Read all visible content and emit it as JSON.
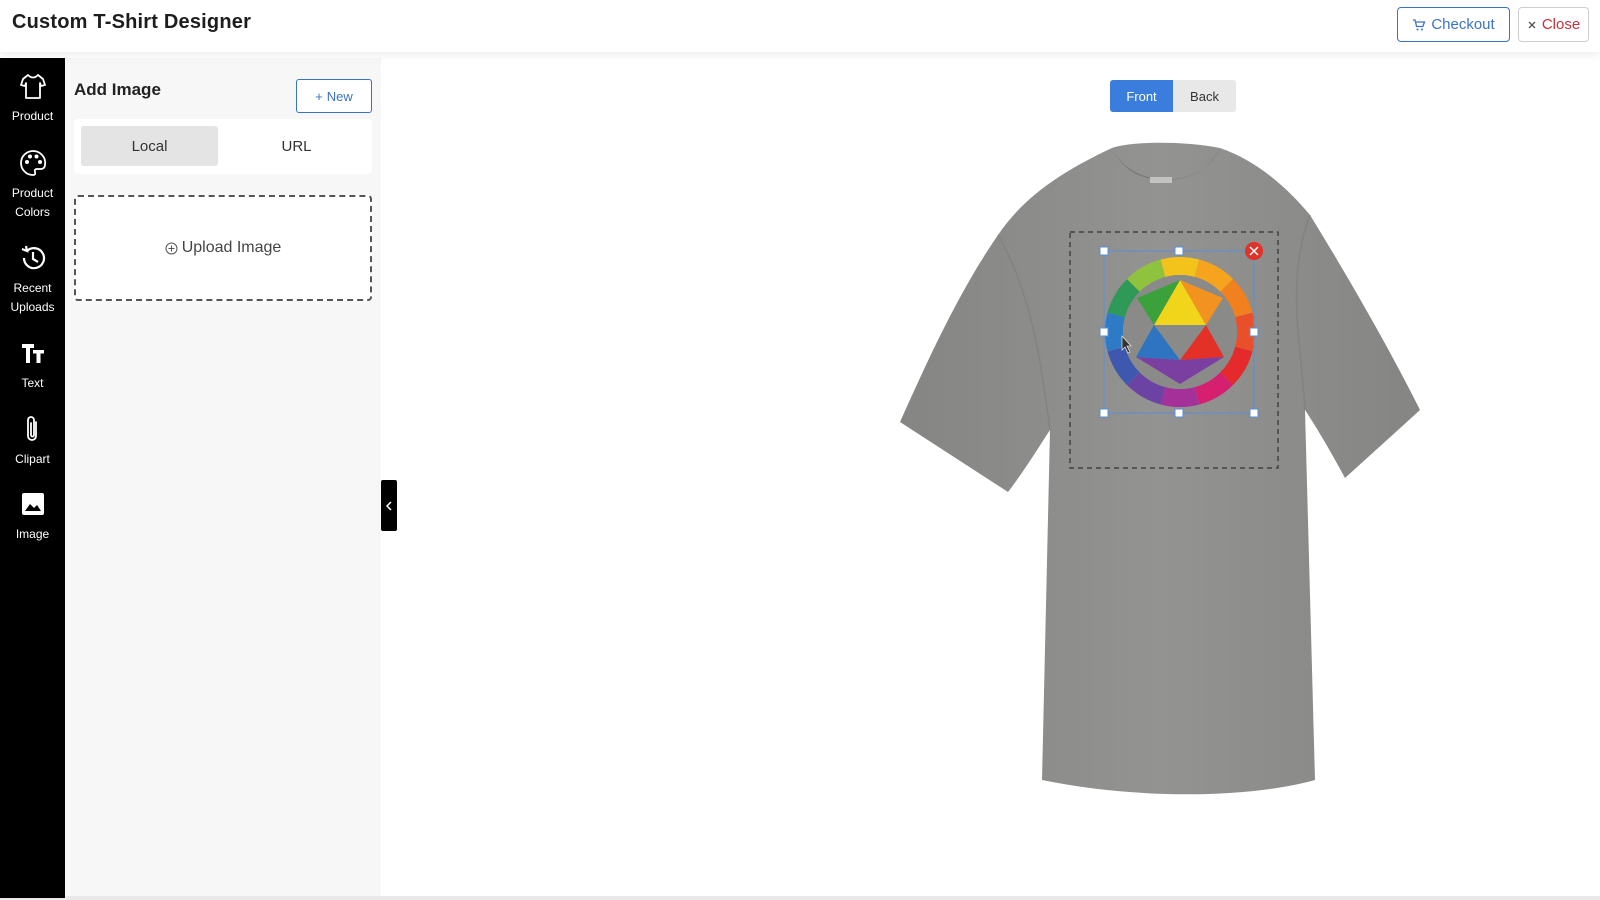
{
  "header": {
    "title": "Custom T-Shirt Designer",
    "checkout_label": "Checkout",
    "close_label": "Close"
  },
  "sidebar": {
    "items": [
      {
        "label": "Product",
        "icon": "tshirt-icon"
      },
      {
        "label": "Product Colors",
        "icon": "palette-icon"
      },
      {
        "label": "Recent Uploads",
        "icon": "history-icon"
      },
      {
        "label": "Text",
        "icon": "text-icon"
      },
      {
        "label": "Clipart",
        "icon": "paperclip-icon"
      },
      {
        "label": "Image",
        "icon": "image-icon"
      }
    ]
  },
  "panel": {
    "title": "Add Image",
    "new_label": "New",
    "tabs": [
      {
        "label": "Local",
        "active": true
      },
      {
        "label": "URL",
        "active": false
      }
    ],
    "upload_label": "Upload Image"
  },
  "designer": {
    "views": [
      {
        "label": "Front",
        "active": true
      },
      {
        "label": "Back",
        "active": false
      }
    ],
    "product_color": "#8e8e8c",
    "accent_color": "#3b7ddd"
  }
}
